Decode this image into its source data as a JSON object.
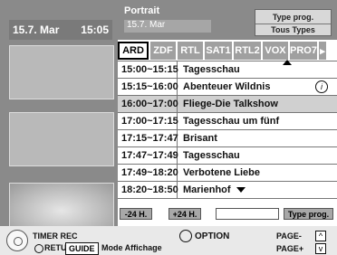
{
  "left": {
    "date": "15.7. Mar",
    "time": "15:05"
  },
  "header": {
    "title": "Portrait",
    "date": "15.7. Mar",
    "type_prog": "Type prog.",
    "tous_types": "Tous Types"
  },
  "channels": [
    {
      "label": "ARD",
      "selected": true
    },
    {
      "label": "ZDF"
    },
    {
      "label": "RTL"
    },
    {
      "label": "SAT1"
    },
    {
      "label": "RTL2"
    },
    {
      "label": "VOX"
    },
    {
      "label": "PRO7"
    }
  ],
  "programs": [
    {
      "time": "15:00~15:15",
      "title": "Tagesschau"
    },
    {
      "time": "15:15~16:00",
      "title": "Abenteuer Wildnis",
      "info": "i"
    },
    {
      "time": "16:00~17:00",
      "title": "Fliege-Die Talkshow",
      "highlight": true
    },
    {
      "time": "17:00~17:15",
      "title": "Tagesschau um fünf"
    },
    {
      "time": "17:15~17:47",
      "title": "Brisant"
    },
    {
      "time": "17:47~17:49",
      "title": "Tagesschau"
    },
    {
      "time": "17:49~18:20",
      "title": "Verbotene Liebe"
    },
    {
      "time": "18:20~18:50",
      "title": "Marienhof"
    }
  ],
  "nav": {
    "minus24": "-24 H.",
    "plus24": "+24 H.",
    "blank": "",
    "type_prog": "Type prog."
  },
  "legend": {
    "timer_rec": "TIMER REC",
    "return": "RETURN",
    "guide": "GUIDE",
    "mode": "Mode Affichage",
    "option": "OPTION",
    "page_minus": "PAGE-",
    "page_plus": "PAGE+",
    "up_symbol": "^",
    "down_symbol": "v"
  }
}
